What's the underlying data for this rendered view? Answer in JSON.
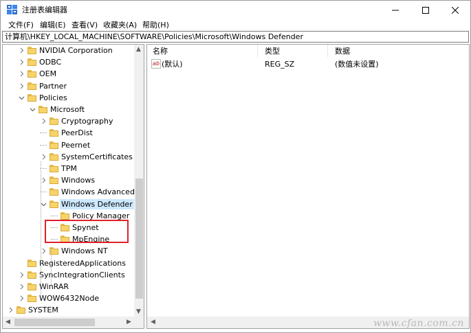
{
  "window": {
    "title": "注册表编辑器",
    "controls": {
      "minimize": "minimize-icon",
      "maximize": "maximize-icon",
      "close": "close-icon"
    }
  },
  "menu": {
    "items": [
      {
        "label": "文件(F)"
      },
      {
        "label": "编辑(E)"
      },
      {
        "label": "查看(V)"
      },
      {
        "label": "收藏夹(A)"
      },
      {
        "label": "帮助(H)"
      }
    ]
  },
  "address": {
    "path": "计算机\\HKEY_LOCAL_MACHINE\\SOFTWARE\\Policies\\Microsoft\\Windows Defender"
  },
  "tree": {
    "items": [
      {
        "label": "NVIDIA Corporation",
        "toggle": "collapsed"
      },
      {
        "label": "ODBC",
        "toggle": "collapsed"
      },
      {
        "label": "OEM",
        "toggle": "collapsed"
      },
      {
        "label": "Partner",
        "toggle": "collapsed"
      },
      {
        "label": "Policies",
        "toggle": "expanded"
      },
      {
        "label": "Microsoft",
        "toggle": "expanded"
      },
      {
        "label": "Cryptography",
        "toggle": "collapsed"
      },
      {
        "label": "PeerDist",
        "toggle": "none"
      },
      {
        "label": "Peernet",
        "toggle": "none"
      },
      {
        "label": "SystemCertificates",
        "toggle": "collapsed"
      },
      {
        "label": "TPM",
        "toggle": "none"
      },
      {
        "label": "Windows",
        "toggle": "collapsed"
      },
      {
        "label": "Windows Advanced T",
        "toggle": "none"
      },
      {
        "label": "Windows Defender",
        "toggle": "expanded",
        "selected": true
      },
      {
        "label": "Policy Manager",
        "toggle": "none"
      },
      {
        "label": "Spynet",
        "toggle": "none",
        "highlighted": true
      },
      {
        "label": "MpEngine",
        "toggle": "none",
        "highlighted": true
      },
      {
        "label": "Windows NT",
        "toggle": "collapsed"
      },
      {
        "label": "RegisteredApplications",
        "toggle": "none"
      },
      {
        "label": "SyncIntegrationClients",
        "toggle": "collapsed"
      },
      {
        "label": "WinRAR",
        "toggle": "collapsed"
      },
      {
        "label": "WOW6432Node",
        "toggle": "collapsed"
      },
      {
        "label": "SYSTEM",
        "toggle": "collapsed"
      }
    ]
  },
  "list": {
    "columns": [
      {
        "label": "名称"
      },
      {
        "label": "类型"
      },
      {
        "label": "数据"
      }
    ],
    "rows": [
      {
        "name": "(默认)",
        "type": "REG_SZ",
        "data": "(数值未设置)",
        "icon": "string-value-icon"
      }
    ]
  },
  "colors": {
    "selection": "#cce8ff",
    "highlight_box": "#e0202a",
    "folder": "#f6d46a"
  },
  "watermark": {
    "text": "www.cfan.com.cn"
  }
}
